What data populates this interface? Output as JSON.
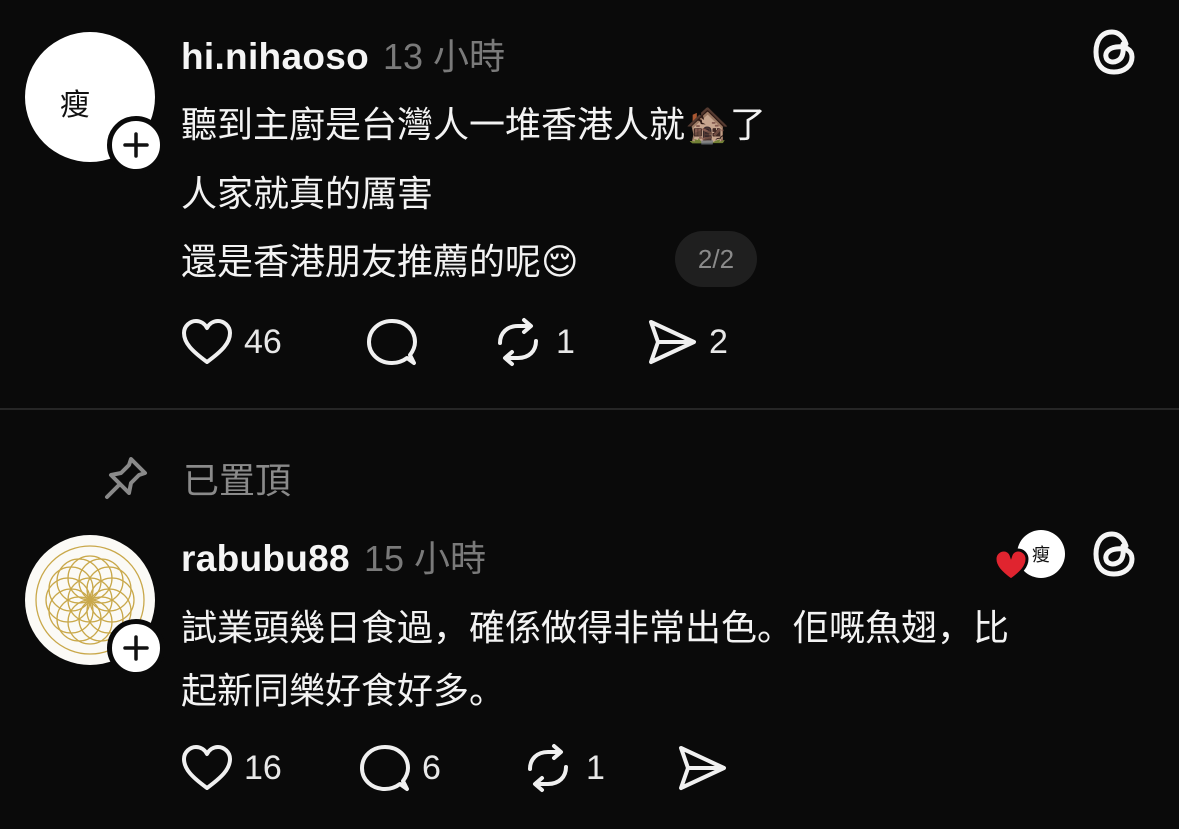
{
  "posts": [
    {
      "username": "hi.nihaoso",
      "time": "13 小時",
      "avatar_char": "瘦",
      "lines": [
        "聽到主廚是台灣人一堆香港人就🏚️了",
        "人家就真的厲害",
        "還是香港朋友推薦的呢😌"
      ],
      "page_badge": "2/2",
      "likes": "46",
      "reposts": "1",
      "shares": "2"
    },
    {
      "username": "rabubu88",
      "time": "15 小時",
      "lines": [
        "試業頭幾日食過，確係做得非常出色。佢嘅魚翅，比",
        "起新同樂好食好多。"
      ],
      "liked_by_avatar_char": "瘦",
      "likes": "16",
      "replies": "6",
      "reposts": "1"
    }
  ],
  "pinned_label": "已置頂",
  "colors": {
    "background": "#0a0a0a",
    "text": "#f3f3f3",
    "muted": "#7a7a7a",
    "like_heart": "#e0242f",
    "gold": "#c9a84a"
  },
  "icons": [
    "threads-icon",
    "plus-icon",
    "heart-icon",
    "comment-icon",
    "repost-icon",
    "share-icon",
    "pin-icon"
  ]
}
